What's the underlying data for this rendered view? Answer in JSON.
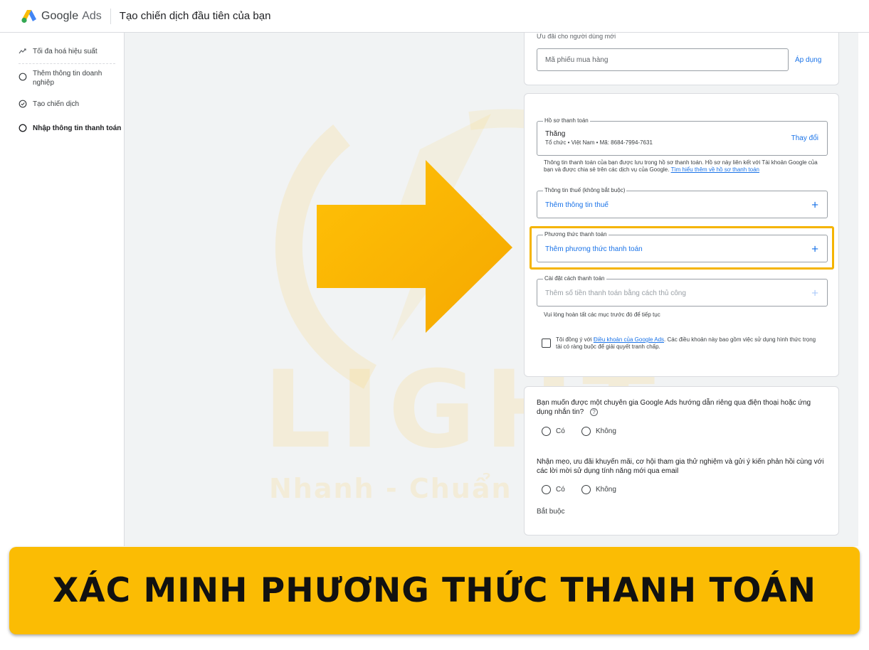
{
  "header": {
    "brand_google": "Google",
    "brand_ads": "Ads",
    "title": "Tạo chiến dịch đầu tiên của bạn"
  },
  "sidebar": {
    "items": [
      {
        "label": "Tối đa hoá hiệu suất",
        "icon": "trend-icon"
      },
      {
        "label": "Thêm thông tin doanh nghiệp",
        "icon": "circle-icon"
      },
      {
        "label": "Tạo chiến dịch",
        "icon": "check-circle-icon"
      },
      {
        "label": "Nhập thông tin thanh toán",
        "icon": "circle-icon"
      }
    ]
  },
  "promo": {
    "heading": "Ưu đãi cho người dùng mới",
    "placeholder": "Mã phiếu mua hàng",
    "apply_label": "Áp dụng"
  },
  "billing": {
    "profile_legend": "Hồ sơ thanh toán",
    "profile_name": "Thăng",
    "profile_details": "Tổ chức • Việt Nam • Mã: 8684-7994-7631",
    "change_label": "Thay đổi",
    "info_text": "Thông tin thanh toán của bạn được lưu trong hồ sơ thanh toán. Hồ sơ này liên kết với Tài khoản Google của bạn và được chia sẻ trên các dịch vụ của Google.",
    "info_link": "Tìm hiểu thêm về hồ sơ thanh toán",
    "tax_legend": "Thông tin thuế (không bắt buộc)",
    "tax_action": "Thêm thông tin thuế",
    "method_legend": "Phương thức thanh toán",
    "method_action": "Thêm phương thức thanh toán",
    "settings_legend": "Cài đặt cách thanh toán",
    "settings_action": "Thêm số tiền thanh toán bằng cách thủ công",
    "settings_hint": "Vui lòng hoàn tất các mục trước đó để tiếp tục",
    "terms_prefix": "Tôi đồng ý với",
    "terms_link": "Điều khoản của Google Ads",
    "terms_suffix": ". Các điều khoản này bao gồm việc sử dụng hình thức trọng tài có ràng buộc để giải quyết tranh chấp.",
    "plus_symbol": "+"
  },
  "contact": {
    "question1": "Bạn muốn được một chuyên gia Google Ads hướng dẫn riêng qua điện thoại hoặc ứng dụng nhắn tin?",
    "help_symbol": "?",
    "yes_label": "Có",
    "no_label": "Không",
    "question2": "Nhận mẹo, ưu đãi khuyến mãi, cơ hội tham gia thử nghiệm và gửi ý kiến phản hồi cùng với các lời mời sử dụng tính năng mới qua email",
    "required_label": "Bắt buộc"
  },
  "watermark": {
    "brand": "LIGHT",
    "slogan": "Nhanh - Chuẩn - Đẹp"
  },
  "banner": {
    "text": "XÁC MINH PHƯƠNG THỨC THANH TOÁN"
  },
  "colors": {
    "accent_blue": "#1a73e8",
    "highlight_yellow": "#f5b400",
    "banner_yellow": "#fbbc04",
    "arrow_yellow": "#fbbc04"
  }
}
